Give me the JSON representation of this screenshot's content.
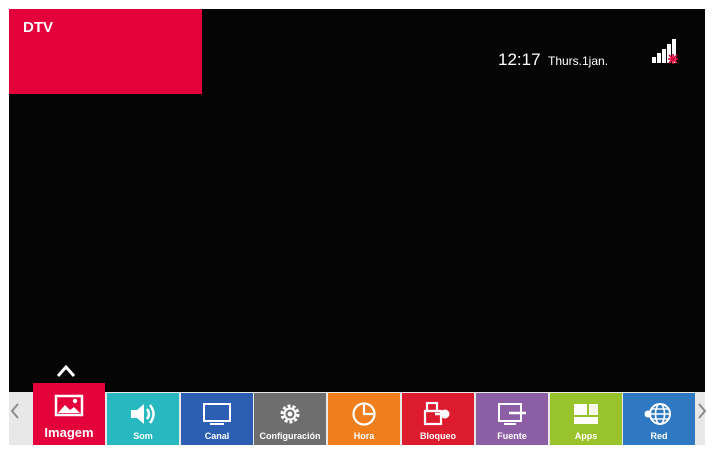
{
  "source": {
    "label": "DTV",
    "color": "#e4003a"
  },
  "status": {
    "time": "12:17",
    "date": "Thurs.1jan.",
    "icon": "signal-strength-icon"
  },
  "menu": {
    "selected_index": 0,
    "items": [
      {
        "label": "Imagem",
        "icon": "picture-icon",
        "color": "#e4003a"
      },
      {
        "label": "Som",
        "icon": "speaker-icon",
        "color": "#27b8c0"
      },
      {
        "label": "Canal",
        "icon": "tv-icon",
        "color": "#2c5fb4"
      },
      {
        "label": "Configuración",
        "icon": "gear-icon",
        "color": "#6e6e6e"
      },
      {
        "label": "Hora",
        "icon": "clock-icon",
        "color": "#f07e1c"
      },
      {
        "label": "Bloqueo",
        "icon": "lock-icon",
        "color": "#dd1b2e"
      },
      {
        "label": "Fuente",
        "icon": "input-source-icon",
        "color": "#8c5ea5"
      },
      {
        "label": "Apps",
        "icon": "apps-icon",
        "color": "#99c32a"
      },
      {
        "label": "Red",
        "icon": "globe-icon",
        "color": "#2f78c2"
      }
    ]
  }
}
